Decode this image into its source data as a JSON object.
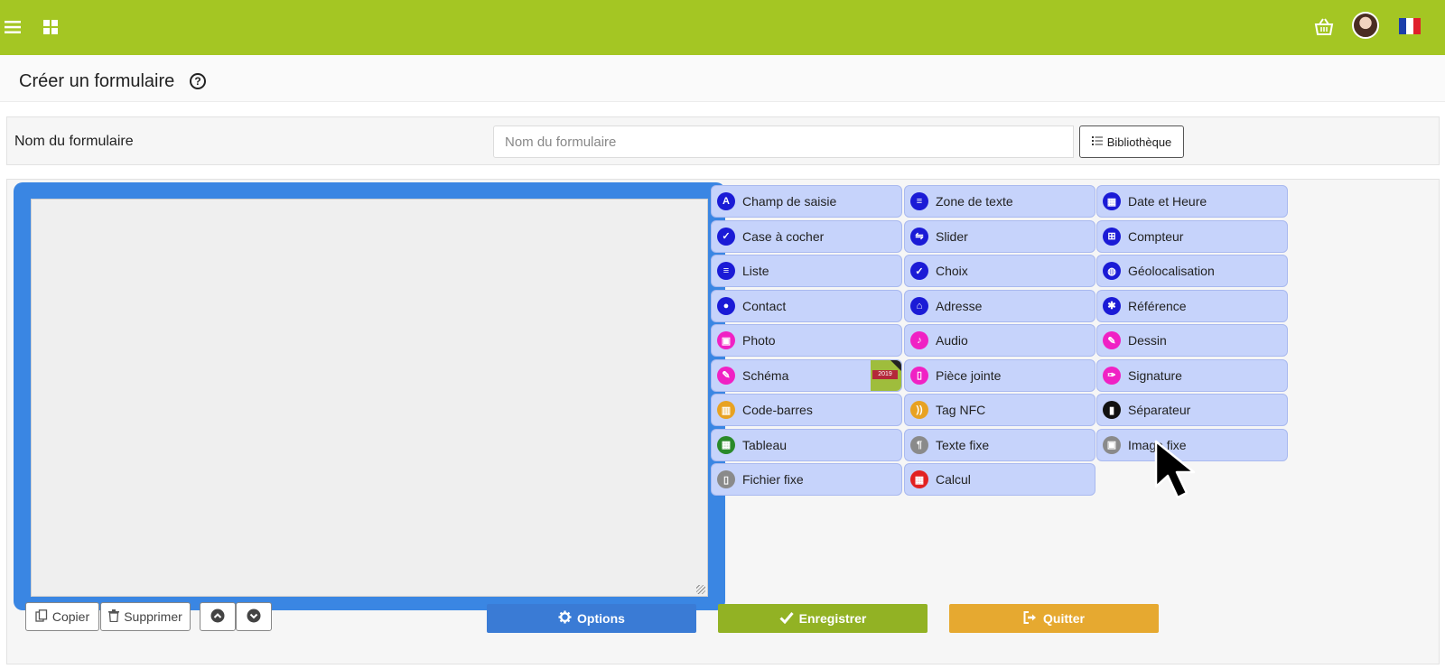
{
  "colors": {
    "topbar": "#a4c623",
    "canvas_frame": "#3a86e3",
    "palette_bg": "#c6d3fb",
    "options": "#3a7bd5",
    "save": "#92b224",
    "quit": "#e6a930"
  },
  "header": {
    "menu_icon": "hamburger-icon",
    "apps_icon": "grid-icon",
    "basket_icon": "basket-icon",
    "flag": "france-flag"
  },
  "page": {
    "title": "Créer un formulaire"
  },
  "form_name": {
    "label": "Nom du formulaire",
    "placeholder": "Nom du formulaire",
    "value": "",
    "library_label": "Bibliothèque"
  },
  "palette": {
    "col1": [
      {
        "label": "Champ de saisie",
        "icon": "A",
        "color": "#1b1bd6"
      },
      {
        "label": "Case à cocher",
        "icon": "✓",
        "color": "#1b1bd6"
      },
      {
        "label": "Liste",
        "icon": "≡",
        "color": "#1b1bd6"
      },
      {
        "label": "Contact",
        "icon": "●",
        "color": "#1b1bd6"
      },
      {
        "label": "Photo",
        "icon": "▣",
        "color": "#f021c4"
      },
      {
        "label": "Schéma",
        "icon": "✎",
        "color": "#f021c4"
      },
      {
        "label": "Code-barres",
        "icon": "▥",
        "color": "#e8a222"
      },
      {
        "label": "Tableau",
        "icon": "▦",
        "color": "#2a8a2a"
      },
      {
        "label": "Fichier fixe",
        "icon": "▯",
        "color": "#8a8a8a"
      }
    ],
    "col2": [
      {
        "label": "Zone de texte",
        "icon": "≡",
        "color": "#1b1bd6"
      },
      {
        "label": "Slider",
        "icon": "⇋",
        "color": "#1b1bd6"
      },
      {
        "label": "Choix",
        "icon": "✓",
        "color": "#1b1bd6"
      },
      {
        "label": "Adresse",
        "icon": "⌂",
        "color": "#1b1bd6"
      },
      {
        "label": "Audio",
        "icon": "♪",
        "color": "#f021c4"
      },
      {
        "label": "Pièce jointe",
        "icon": "▯",
        "color": "#f021c4"
      },
      {
        "label": "Tag NFC",
        "icon": "))",
        "color": "#e8a222"
      },
      {
        "label": "Texte fixe",
        "icon": "¶",
        "color": "#8a8a8a"
      },
      {
        "label": "Calcul",
        "icon": "▦",
        "color": "#e22121"
      }
    ],
    "col3": [
      {
        "label": "Date et Heure",
        "icon": "▦",
        "color": "#1b1bd6"
      },
      {
        "label": "Compteur",
        "icon": "⊞",
        "color": "#1b1bd6"
      },
      {
        "label": "Géolocalisation",
        "icon": "◍",
        "color": "#1b1bd6"
      },
      {
        "label": "Référence",
        "icon": "✱",
        "color": "#1b1bd6"
      },
      {
        "label": "Dessin",
        "icon": "✎",
        "color": "#f021c4"
      },
      {
        "label": "Signature",
        "icon": "✑",
        "color": "#f021c4"
      },
      {
        "label": "Séparateur",
        "icon": "▮",
        "color": "#111111"
      },
      {
        "label": "Image fixe",
        "icon": "▣",
        "color": "#8a8a8a"
      }
    ],
    "badge_year": "2019"
  },
  "actions": {
    "copy": "Copier",
    "delete": "Supprimer",
    "options": "Options",
    "save": "Enregistrer",
    "quit": "Quitter"
  }
}
